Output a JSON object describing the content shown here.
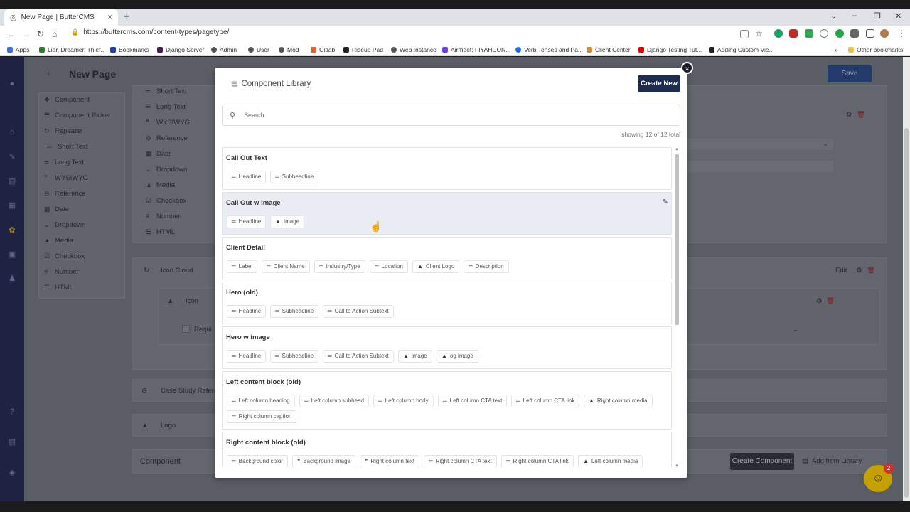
{
  "browser": {
    "tab_title": "New Page | ButterCMS",
    "url": "https://buttercms.com/content-types/pagetype/",
    "bookmarks": [
      "Apps",
      "Liar, Dreamer, Thief...",
      "Bookmarks",
      "Django Server",
      "Admin",
      "User",
      "Mod",
      "Gitlab",
      "Riseup Pad",
      "Web Instance",
      "Airmeet: FIYAHCON...",
      "Verb Tenses and Pa...",
      "Client Center",
      "Django Testing Tut...",
      "Adding Custom Vie...",
      "Other bookmarks"
    ]
  },
  "page": {
    "title": "New Page",
    "save_label": "Save",
    "sidebar_left": [
      "Component",
      "Component Picker",
      "Repeater",
      "Short Text",
      "Long Text",
      "WYSIWYG",
      "Reference",
      "Date",
      "Dropdown",
      "Media",
      "Checkbox",
      "Number",
      "HTML"
    ],
    "sidebar_inner": [
      "Short Text",
      "Long Text",
      "WYSIWYG",
      "Reference",
      "Date",
      "Dropdown",
      "Media",
      "Checkbox",
      "Number",
      "HTML"
    ],
    "icon_cloud": "Icon Cloud",
    "icon_label": "Icon",
    "require_label": "Requi",
    "case_study": "Case Study Refere",
    "logo_label": "Logo",
    "component_label": "Component",
    "edit_label": "Edit",
    "create_component": "Create Component",
    "add_from_library": "Add from Library",
    "chat_badge": "2"
  },
  "modal": {
    "title": "Component Library",
    "create_new": "Create New",
    "search_placeholder": "Search",
    "showing": "showing 12 of 12 total",
    "components": [
      {
        "name": "Call Out Text",
        "fields": [
          "Headline",
          "Subheadline"
        ]
      },
      {
        "name": "Call Out w Image",
        "fields": [
          "Headline",
          "Image"
        ]
      },
      {
        "name": "Client Detail",
        "fields": [
          "Label",
          "Client Name",
          "Industry/Type",
          "Location",
          "Client Logo",
          "Description"
        ]
      },
      {
        "name": "Hero (old)",
        "fields": [
          "Headline",
          "Subheadline",
          "Call to Action Subtext"
        ]
      },
      {
        "name": "Hero w image",
        "fields": [
          "Headline",
          "Subheadline",
          "Call to Action Subtext",
          "image",
          "og image"
        ]
      },
      {
        "name": "Left content block (old)",
        "fields": [
          "Left column heading",
          "Left column subhead",
          "Left column body",
          "Left column CTA text",
          "Left column CTA link",
          "Right column media",
          "Right column caption"
        ]
      },
      {
        "name": "Right content block (old)",
        "fields": [
          "Background color",
          "Background image",
          "Right column text",
          "Right column CTA text",
          "Right column CTA link",
          "Left column media"
        ]
      }
    ]
  }
}
